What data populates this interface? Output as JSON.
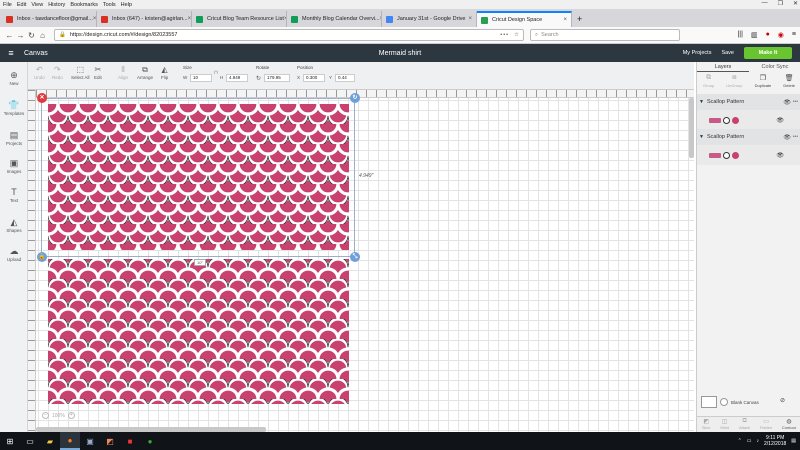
{
  "menubar": {
    "items": [
      "File",
      "Edit",
      "View",
      "History",
      "Bookmarks",
      "Tools",
      "Help"
    ]
  },
  "browser": {
    "tabs": [
      {
        "title": "Inbox - tawdancefloor@gmail...",
        "favicon_color": "#d93025"
      },
      {
        "title": "Inbox (647) - kristen@agirlan...",
        "favicon_color": "#d93025"
      },
      {
        "title": "Cricut Blog Team Resource List",
        "favicon_color": "#0f9d58"
      },
      {
        "title": "Monthly Blog Calendar Overvi...",
        "favicon_color": "#0f9d58"
      },
      {
        "title": "January 31st - Google Drive",
        "favicon_color": "#4285f4"
      },
      {
        "title": "Cricut Design Space",
        "favicon_color": "#2d9d54",
        "active": true
      }
    ],
    "new_tab_label": "+",
    "url": "https://design.cricut.com/#/design/82023557",
    "url_menu": "•••",
    "search_placeholder": "Search"
  },
  "app": {
    "canvas_label": "Canvas",
    "project_title": "Mermaid shirt",
    "my_projects": "My Projects",
    "save": "Save",
    "make_it": "Make It"
  },
  "toolbar": {
    "undo": "Undo",
    "redo": "Redo",
    "select_all": "Select All",
    "edit": "Edit",
    "align": "Align",
    "arrange": "Arrange",
    "flip": "Flip",
    "size_label": "Size",
    "w_label": "W",
    "w_value": "10",
    "h_label": "H",
    "h_value": "4.949",
    "rotate_label": "Rotate",
    "rotate_value": "179.95",
    "position_label": "Position",
    "x_label": "X",
    "x_value": "0.300",
    "y_label": "Y",
    "y_value": "0.44"
  },
  "leftnav": {
    "items": [
      {
        "label": "New",
        "icon": "plus-icon"
      },
      {
        "label": "Templates",
        "icon": "shirt-icon"
      },
      {
        "label": "Projects",
        "icon": "folder-icon"
      },
      {
        "label": "Images",
        "icon": "image-icon"
      },
      {
        "label": "Text",
        "icon": "text-icon"
      },
      {
        "label": "Shapes",
        "icon": "shapes-icon"
      },
      {
        "label": "Upload",
        "icon": "upload-icon"
      }
    ]
  },
  "canvas": {
    "height_dimension": "4.949\"",
    "width_tag": "10\"",
    "zoom": "100%",
    "pattern_fill": "#c8416f",
    "pattern_outline": "#2a2a2a"
  },
  "panel": {
    "tabs": [
      "Layers",
      "Color Sync"
    ],
    "actions": [
      "Group",
      "UnGroup",
      "Duplicate",
      "Delete"
    ],
    "layers": [
      {
        "name": "Scallop Pattern",
        "swatch": "#c85a88",
        "dot": "#c8416f"
      },
      {
        "name": "Scallop Pattern",
        "swatch": "#c85a88",
        "dot": "#c8416f"
      }
    ],
    "blank_canvas": "Blank Canvas",
    "bottom_actions": [
      "Slice",
      "Weld",
      "Attach",
      "Flatten",
      "Contour"
    ]
  },
  "taskbar": {
    "time": "9:11 PM",
    "date": "2/12/2018"
  }
}
